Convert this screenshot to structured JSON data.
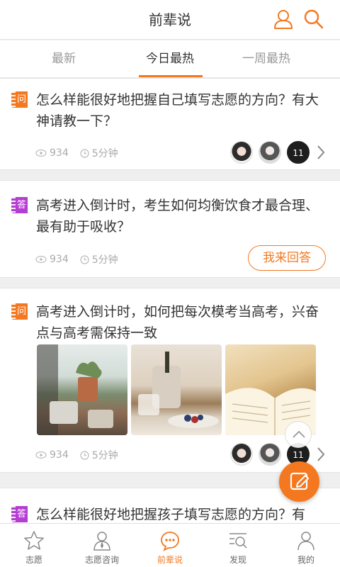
{
  "header": {
    "title": "前辈说",
    "profile_icon": "user-icon",
    "search_icon": "search-icon"
  },
  "tabs": [
    {
      "label": "最新",
      "active": false
    },
    {
      "label": "今日最热",
      "active": true
    },
    {
      "label": "一周最热",
      "active": false
    }
  ],
  "posts": [
    {
      "tag": "问",
      "text": "怎么样能很好地把握自己填写志愿的方向？有大神请教一下？",
      "views": "934",
      "time": "5分钟",
      "answer_count": "11"
    },
    {
      "tag": "答",
      "text": "高考进入倒计时，考生如何均衡饮食才最合理、最有助于吸收？",
      "views": "934",
      "time": "5分钟",
      "action": "我来回答"
    },
    {
      "tag": "问",
      "text": "高考进入倒计时，如何把每次模考当高考，兴奋点与高考需保持一致",
      "views": "934",
      "time": "5分钟",
      "answer_count": "11"
    },
    {
      "tag": "答",
      "text": "怎么样能很好地把握孩子填写志愿的方向？有"
    }
  ],
  "colors": {
    "accent": "#f4781f",
    "answer_tag": "#b43ed1"
  },
  "bottom_nav": [
    {
      "label": "志愿",
      "icon": "star-icon",
      "active": false
    },
    {
      "label": "志愿咨询",
      "icon": "person-icon",
      "active": false
    },
    {
      "label": "前辈说",
      "icon": "chat-bubble-icon",
      "active": true
    },
    {
      "label": "发现",
      "icon": "discover-icon",
      "active": false
    },
    {
      "label": "我的",
      "icon": "profile-icon",
      "active": false
    }
  ]
}
